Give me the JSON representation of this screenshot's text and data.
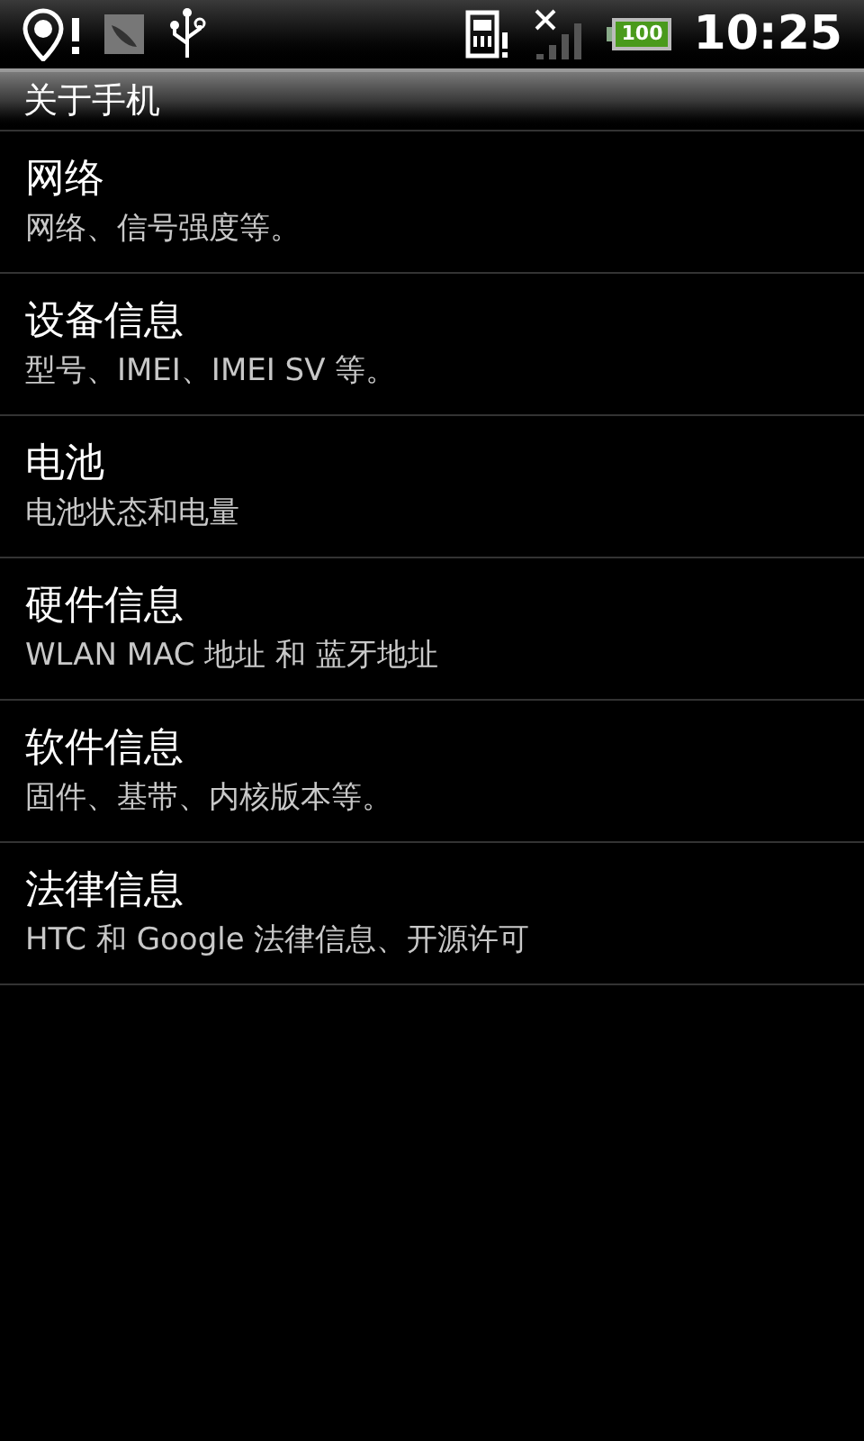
{
  "status_bar": {
    "battery": "100",
    "time": "10:25"
  },
  "title": "关于手机",
  "items": [
    {
      "title": "网络",
      "summary": "网络、信号强度等。"
    },
    {
      "title": "设备信息",
      "summary": "型号、IMEI、IMEI SV 等。"
    },
    {
      "title": "电池",
      "summary": "电池状态和电量"
    },
    {
      "title": "硬件信息",
      "summary": "WLAN MAC 地址 和 蓝牙地址"
    },
    {
      "title": "软件信息",
      "summary": "固件、基带、内核版本等。"
    },
    {
      "title": "法律信息",
      "summary": "HTC 和 Google 法律信息、开源许可"
    }
  ]
}
